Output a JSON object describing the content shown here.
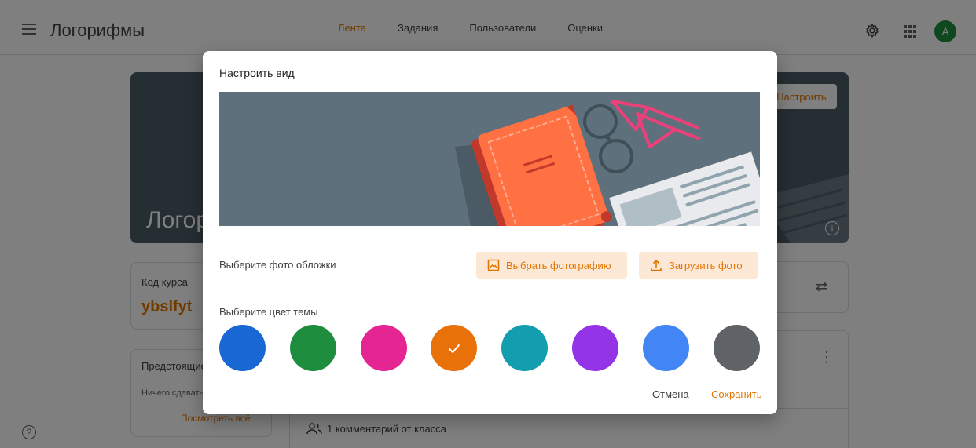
{
  "app": {
    "title": "Логорифмы",
    "nav": [
      "Лента",
      "Задания",
      "Пользователи",
      "Оценки"
    ],
    "avatar_letter": "A",
    "accent_color": "#e37400"
  },
  "banner": {
    "course_title": "Логорифмы",
    "customize_label": "Настроить"
  },
  "code_card": {
    "label": "Код курса",
    "code": "ybslfyt"
  },
  "upcoming": {
    "title": "Предстоящие",
    "empty": "Ничего сдавать не нужно",
    "view_all": "Посмотреть всё"
  },
  "stream": {
    "comments": "1 комментарий от класса"
  },
  "dialog": {
    "title": "Настроить вид",
    "photo_label": "Выберите фото обложки",
    "select_photo": "Выбрать фотографию",
    "upload_photo": "Загрузить фото",
    "theme_label": "Выберите цвет темы",
    "cancel": "Отмена",
    "save": "Сохранить"
  },
  "theme_colors": [
    {
      "name": "blue",
      "color": "#1967d2",
      "selected": false
    },
    {
      "name": "green",
      "color": "#1e8e3e",
      "selected": false
    },
    {
      "name": "pink",
      "color": "#e52592",
      "selected": false
    },
    {
      "name": "orange",
      "color": "#e8710a",
      "selected": true
    },
    {
      "name": "teal",
      "color": "#129eaf",
      "selected": false
    },
    {
      "name": "purple",
      "color": "#9334e6",
      "selected": false
    },
    {
      "name": "light-blue",
      "color": "#4285f4",
      "selected": false
    },
    {
      "name": "gray",
      "color": "#5f6368",
      "selected": false
    }
  ]
}
